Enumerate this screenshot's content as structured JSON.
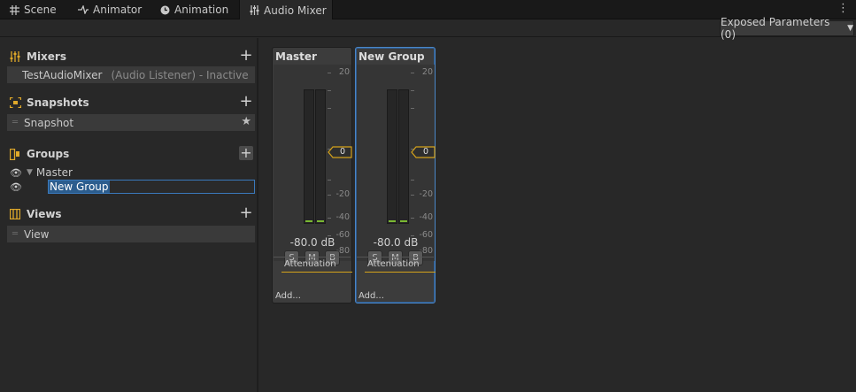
{
  "tabs": [
    {
      "label": "Scene",
      "icon": "grid-icon"
    },
    {
      "label": "Animator",
      "icon": "animator-icon"
    },
    {
      "label": "Animation",
      "icon": "clock-icon"
    },
    {
      "label": "Audio Mixer",
      "icon": "mixer-icon",
      "active": true
    }
  ],
  "toolbar": {
    "exposed_label": "Exposed Parameters (0)"
  },
  "sections": {
    "mixers": {
      "title": "Mixers",
      "items": [
        {
          "name": "TestAudioMixer",
          "note": "(Audio Listener) - Inactive"
        }
      ]
    },
    "snapshots": {
      "title": "Snapshots",
      "items": [
        {
          "name": "Snapshot"
        }
      ]
    },
    "groups": {
      "title": "Groups",
      "items": [
        {
          "name": "Master"
        },
        {
          "name": "New Group"
        }
      ]
    },
    "views": {
      "title": "Views",
      "items": [
        {
          "name": "View"
        }
      ]
    }
  },
  "ticks": [
    "20",
    "0",
    "-20",
    "-40",
    "-60",
    "-80"
  ],
  "strips": [
    {
      "title": "Master",
      "fader_value": "0",
      "db": "-80.0 dB",
      "s": "S",
      "m": "M",
      "b": "B",
      "effect": "Attenuation",
      "add": "Add..."
    },
    {
      "title": "New Group",
      "fader_value": "0",
      "db": "-80.0 dB",
      "s": "S",
      "m": "M",
      "b": "B",
      "effect": "Attenuation",
      "add": "Add..."
    }
  ],
  "colors": {
    "accent": "#d4a21b",
    "selection": "#3a79bb",
    "meter": "#7ab832"
  }
}
